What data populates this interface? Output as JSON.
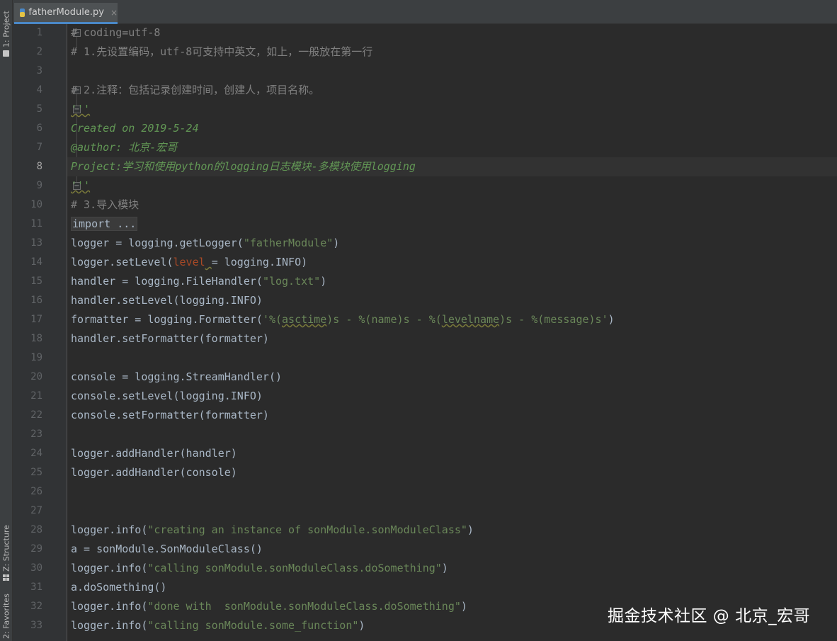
{
  "toolwindows": {
    "project": "1: Project",
    "structure": "Z: Structure",
    "favorites": "2: Favorites"
  },
  "tab": {
    "filename": "fatherModule.py",
    "close": "×"
  },
  "current_line": "8",
  "lines": [
    {
      "num": "1",
      "parts": [
        {
          "t": "# coding=utf-8",
          "c": "cmt"
        }
      ]
    },
    {
      "num": "2",
      "parts": [
        {
          "t": "# 1.先设置编码，utf-8可支持中英文，如上，一般放在第一行",
          "c": "cmt"
        }
      ]
    },
    {
      "num": "3",
      "parts": []
    },
    {
      "num": "4",
      "parts": [
        {
          "t": "# 2.注释：包括记录创建时间，创建人，项目名称。",
          "c": "cmt"
        }
      ]
    },
    {
      "num": "5",
      "parts": [
        {
          "t": "'''",
          "c": "doc warn"
        }
      ]
    },
    {
      "num": "6",
      "parts": [
        {
          "t": "Created on 2019-5-24",
          "c": "doc"
        }
      ]
    },
    {
      "num": "7",
      "parts": [
        {
          "t": "@author: 北京-宏哥",
          "c": "doc"
        }
      ]
    },
    {
      "num": "8",
      "parts": [
        {
          "t": "Project:学习和使用python的logging日志模块-多模块使用logging",
          "c": "doc"
        }
      ]
    },
    {
      "num": "9",
      "parts": [
        {
          "t": "'''",
          "c": "doc warn"
        }
      ]
    },
    {
      "num": "10",
      "parts": [
        {
          "t": "# 3.导入模块",
          "c": "cmt"
        }
      ]
    },
    {
      "num": "11",
      "parts": [
        {
          "t": "import ...",
          "c": "folded"
        }
      ]
    },
    {
      "num": "13",
      "parts": [
        {
          "t": "logger = logging.getLogger("
        },
        {
          "t": "\"fatherModule\"",
          "c": "str"
        },
        {
          "t": ")"
        }
      ]
    },
    {
      "num": "14",
      "parts": [
        {
          "t": "logger.setLevel("
        },
        {
          "t": "level",
          "c": "param"
        },
        {
          "t": " ",
          "c": "warn"
        },
        {
          "t": "= logging.INFO)"
        }
      ]
    },
    {
      "num": "15",
      "parts": [
        {
          "t": "handler = logging.FileHandler("
        },
        {
          "t": "\"log.txt\"",
          "c": "str"
        },
        {
          "t": ")"
        }
      ]
    },
    {
      "num": "16",
      "parts": [
        {
          "t": "handler.setLevel(logging.INFO)"
        }
      ]
    },
    {
      "num": "17",
      "parts": [
        {
          "t": "formatter = logging.Formatter("
        },
        {
          "t": "'%(",
          "c": "str"
        },
        {
          "t": "asctime",
          "c": "str warn"
        },
        {
          "t": ")s - %(name)s - %(",
          "c": "str"
        },
        {
          "t": "levelname",
          "c": "str warn"
        },
        {
          "t": ")s - %(message)s'",
          "c": "str"
        },
        {
          "t": ")"
        }
      ]
    },
    {
      "num": "18",
      "parts": [
        {
          "t": "handler.setFormatter(formatter)"
        }
      ]
    },
    {
      "num": "19",
      "parts": []
    },
    {
      "num": "20",
      "parts": [
        {
          "t": "console = logging.StreamHandler()"
        }
      ]
    },
    {
      "num": "21",
      "parts": [
        {
          "t": "console.setLevel(logging.INFO)"
        }
      ]
    },
    {
      "num": "22",
      "parts": [
        {
          "t": "console.setFormatter(formatter)"
        }
      ]
    },
    {
      "num": "23",
      "parts": []
    },
    {
      "num": "24",
      "parts": [
        {
          "t": "logger.addHandler(handler)"
        }
      ]
    },
    {
      "num": "25",
      "parts": [
        {
          "t": "logger.addHandler(console)"
        }
      ]
    },
    {
      "num": "26",
      "parts": []
    },
    {
      "num": "27",
      "parts": []
    },
    {
      "num": "28",
      "parts": [
        {
          "t": "logger.info("
        },
        {
          "t": "\"creating an instance of sonModule.sonModuleClass\"",
          "c": "str"
        },
        {
          "t": ")"
        }
      ]
    },
    {
      "num": "29",
      "parts": [
        {
          "t": "a = sonModule.SonModuleClass()"
        }
      ]
    },
    {
      "num": "30",
      "parts": [
        {
          "t": "logger.info("
        },
        {
          "t": "\"calling sonModule.sonModuleClass.doSomething\"",
          "c": "str"
        },
        {
          "t": ")"
        }
      ]
    },
    {
      "num": "31",
      "parts": [
        {
          "t": "a.doSomething()"
        }
      ]
    },
    {
      "num": "32",
      "parts": [
        {
          "t": "logger.info("
        },
        {
          "t": "\"done with  sonModule.sonModuleClass.doSomething\"",
          "c": "str"
        },
        {
          "t": ")"
        }
      ]
    },
    {
      "num": "33",
      "parts": [
        {
          "t": "logger.info("
        },
        {
          "t": "\"calling sonModule.some_function\"",
          "c": "str"
        },
        {
          "t": ")"
        }
      ]
    }
  ],
  "watermark": "掘金技术社区 @ 北京_宏哥"
}
